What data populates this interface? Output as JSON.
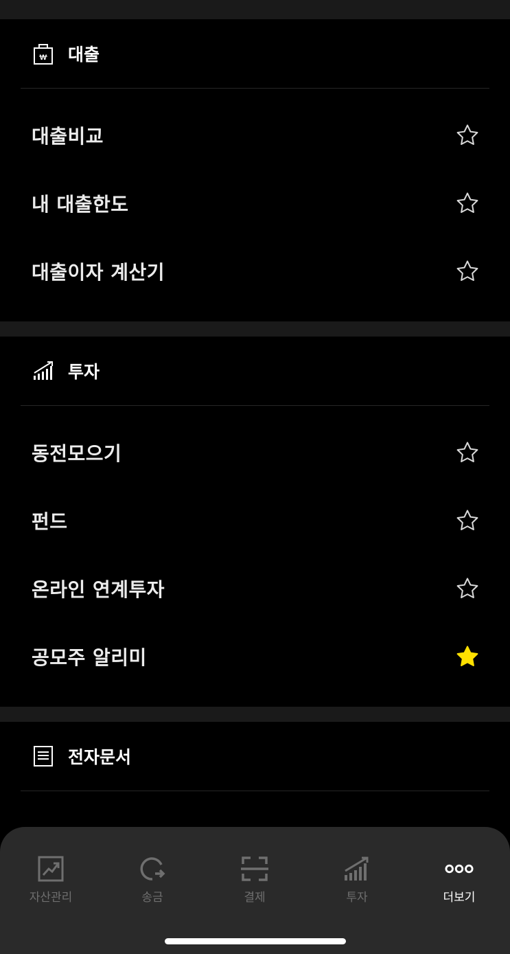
{
  "sections": [
    {
      "title": "대출",
      "icon": "loan-bag-icon",
      "items": [
        {
          "label": "대출비교",
          "favorite": false
        },
        {
          "label": "내 대출한도",
          "favorite": false
        },
        {
          "label": "대출이자 계산기",
          "favorite": false
        }
      ]
    },
    {
      "title": "투자",
      "icon": "bar-chart-icon",
      "items": [
        {
          "label": "동전모으기",
          "favorite": false
        },
        {
          "label": "펀드",
          "favorite": false
        },
        {
          "label": "온라인 연계투자",
          "favorite": false
        },
        {
          "label": "공모주 알리미",
          "favorite": true
        }
      ]
    },
    {
      "title": "전자문서",
      "icon": "document-icon",
      "items": []
    }
  ],
  "tabbar": {
    "tabs": [
      {
        "label": "자산관리",
        "icon": "asset-chart-icon",
        "active": false
      },
      {
        "label": "송금",
        "icon": "transfer-icon",
        "active": false
      },
      {
        "label": "결제",
        "icon": "scan-icon",
        "active": false
      },
      {
        "label": "투자",
        "icon": "invest-bars-icon",
        "active": false
      },
      {
        "label": "더보기",
        "icon": "more-dots-icon",
        "active": true
      }
    ]
  },
  "colors": {
    "background": "#000000",
    "section_gap": "#1a1a1a",
    "favorite_star": "#ffe000",
    "tabbar": "#2a2a2a",
    "tab_inactive": "#6f6f6f",
    "tab_active": "#ffffff"
  }
}
